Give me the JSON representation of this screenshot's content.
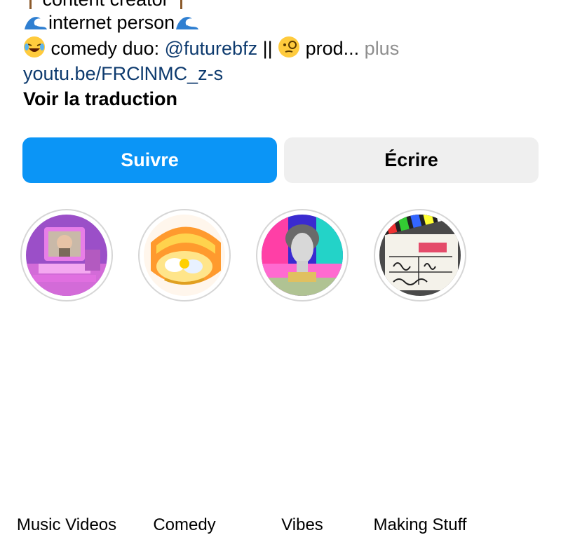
{
  "bio": {
    "line_clipped": "content creator",
    "line_2": "internet person",
    "line_3_prefix": "comedy duo: ",
    "line_3_handle": "@futurebfz",
    "line_3_sep": " || ",
    "line_3_text": " prod...",
    "line_3_more": "plus",
    "link": "youtu.be/FRClNMC_z-s",
    "translate": "Voir la traduction"
  },
  "buttons": {
    "follow": "Suivre",
    "message": "Écrire"
  },
  "colors": {
    "follow_bg": "#0b95f6",
    "message_bg": "#efefef",
    "link": "#0d3a6e",
    "muted": "#8e8e8e"
  },
  "highlights": [
    {
      "label": "Music Videos",
      "icon": "retro-computer-thumbnail"
    },
    {
      "label": "Comedy",
      "icon": "cartoon-sushi-roll-thumbnail"
    },
    {
      "label": "Vibes",
      "icon": "vaporwave-statue-thumbnail"
    },
    {
      "label": "Making Stuff",
      "icon": "film-clapperboard-thumbnail"
    }
  ]
}
